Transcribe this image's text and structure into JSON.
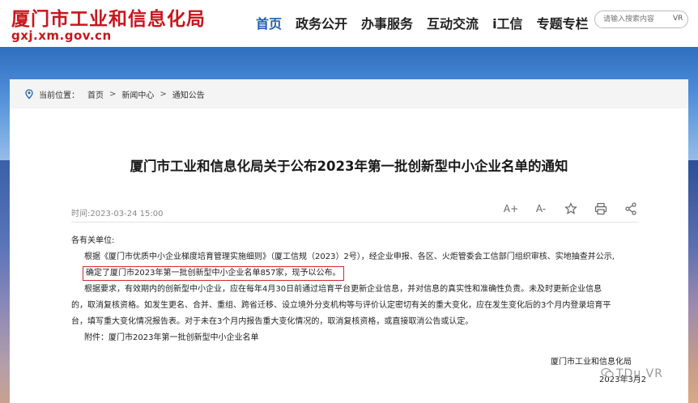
{
  "header": {
    "site_title": "厦门市工业和信息化局",
    "domain": "gxj.xm.gov.cn",
    "nav": [
      "首页",
      "政务公开",
      "办事服务",
      "互动交流",
      "i工信",
      "专题专栏"
    ],
    "search_placeholder": "请输入搜索内容",
    "search_extra": "VR"
  },
  "breadcrumb": {
    "label": "当前位置：",
    "items": [
      "首页",
      "新闻中心",
      "通知公告"
    ]
  },
  "article": {
    "title": "厦门市工业和信息化局关于公布2023年第一批创新型中小企业名单的通知",
    "time": "时间:2023-03-24 15:00",
    "tool_font_up": "A+",
    "tool_font_down": "A-",
    "salutation": "各有关单位:",
    "p1": "根据《厦门市优质中小企业梯度培育管理实施细则》（厦工信规（2023）2号），经企业申报、各区、火炬管委会工信部门组织审核、实地抽查并公示,",
    "p1_highlight": "确定了厦门市2023年第一批创新型中小企业名单857家，现予以公布。",
    "p2_line1": "根据要求，有效期内的创新型中小企业，应在每年4月30日前通过培育平台更新企业信息，并对信息的真实性和准确性负责。未及时更新企业信息",
    "p2_line2": "的，取消复核资格。如发生更名、合并、重组、跨省迁移、设立境外分支机构等与评价认定密切有关的重大变化，应在发生变化后的3个月内登录培育平",
    "p2_line3": "台，填写重大变化情况报告表。对于未在3个月内报告重大变化情况的，取消复核资格，或直接取消公告或认定。",
    "attachment": "附件：厦门市2023年第一批创新型中小企业名单",
    "signature": "厦门市工业和信息化局",
    "date_sign": "2023年3月2"
  },
  "watermark": "TDu VR"
}
